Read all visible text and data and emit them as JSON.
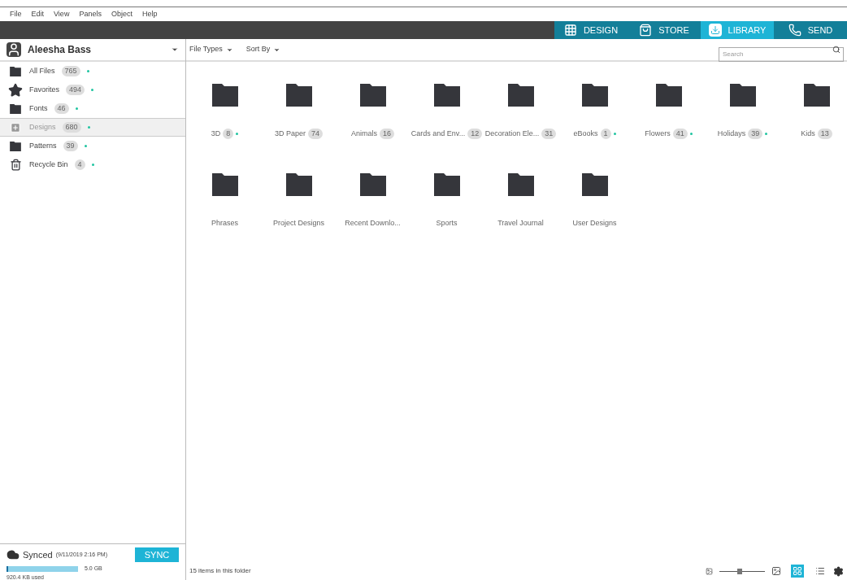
{
  "menu": [
    "File",
    "Edit",
    "View",
    "Panels",
    "Object",
    "Help"
  ],
  "tabs": [
    {
      "label": "DESIGN",
      "kind": "design",
      "selected": false
    },
    {
      "label": "STORE",
      "kind": "store",
      "selected": false
    },
    {
      "label": "LIBRARY",
      "kind": "library",
      "selected": true
    },
    {
      "label": "SEND",
      "kind": "send",
      "selected": false
    }
  ],
  "user": {
    "name": "Aleesha Bass"
  },
  "sidebar": {
    "items": [
      {
        "label": "All Files",
        "count": "765",
        "kind": "folder",
        "synced": true,
        "selected": false
      },
      {
        "label": "Favorites",
        "count": "494",
        "kind": "favorites",
        "synced": true,
        "selected": false
      },
      {
        "label": "Fonts",
        "count": "46",
        "kind": "folder",
        "synced": true,
        "selected": false
      },
      {
        "label": "Designs",
        "count": "680",
        "kind": "designs",
        "synced": true,
        "selected": true
      },
      {
        "label": "Patterns",
        "count": "39",
        "kind": "folder",
        "synced": true,
        "selected": false
      },
      {
        "label": "Recycle Bin",
        "count": "4",
        "kind": "trash",
        "synced": true,
        "selected": false
      }
    ]
  },
  "toolbar": {
    "filters": [
      "File Types",
      "Sort By"
    ],
    "search": {
      "placeholder": "Search"
    }
  },
  "folders": [
    {
      "name": "3D",
      "count": "8",
      "synced": true
    },
    {
      "name": "3D Paper",
      "count": "74",
      "synced": false
    },
    {
      "name": "Animals",
      "count": "16",
      "synced": false
    },
    {
      "name": "Cards and Env...",
      "count": "12",
      "synced": false
    },
    {
      "name": "Decoration Ele...",
      "count": "31",
      "synced": false
    },
    {
      "name": "eBooks",
      "count": "1",
      "synced": true
    },
    {
      "name": "Flowers",
      "count": "41",
      "synced": true
    },
    {
      "name": "Holidays",
      "count": "39",
      "synced": true
    },
    {
      "name": "Kids",
      "count": "13",
      "synced": false
    },
    {
      "name": "Phrases",
      "synced": false
    },
    {
      "name": "Project Designs",
      "synced": false
    },
    {
      "name": "Recent Downlo...",
      "synced": false
    },
    {
      "name": "Sports",
      "synced": false
    },
    {
      "name": "Travel Journal",
      "synced": false
    },
    {
      "name": "User Designs",
      "synced": false
    }
  ],
  "sync": {
    "status": "Synced",
    "time": "(9/11/2019 2:16 PM)",
    "button": "SYNC",
    "capacity": "5.0 GB",
    "used": "920.4 KB used",
    "level": 0.0002
  },
  "status_bar": {
    "text": "15 items in this folder",
    "zoom": {
      "level": 0.45
    },
    "views": [
      {
        "kind": "grid",
        "selected": true
      },
      {
        "kind": "list",
        "selected": false
      }
    ]
  }
}
